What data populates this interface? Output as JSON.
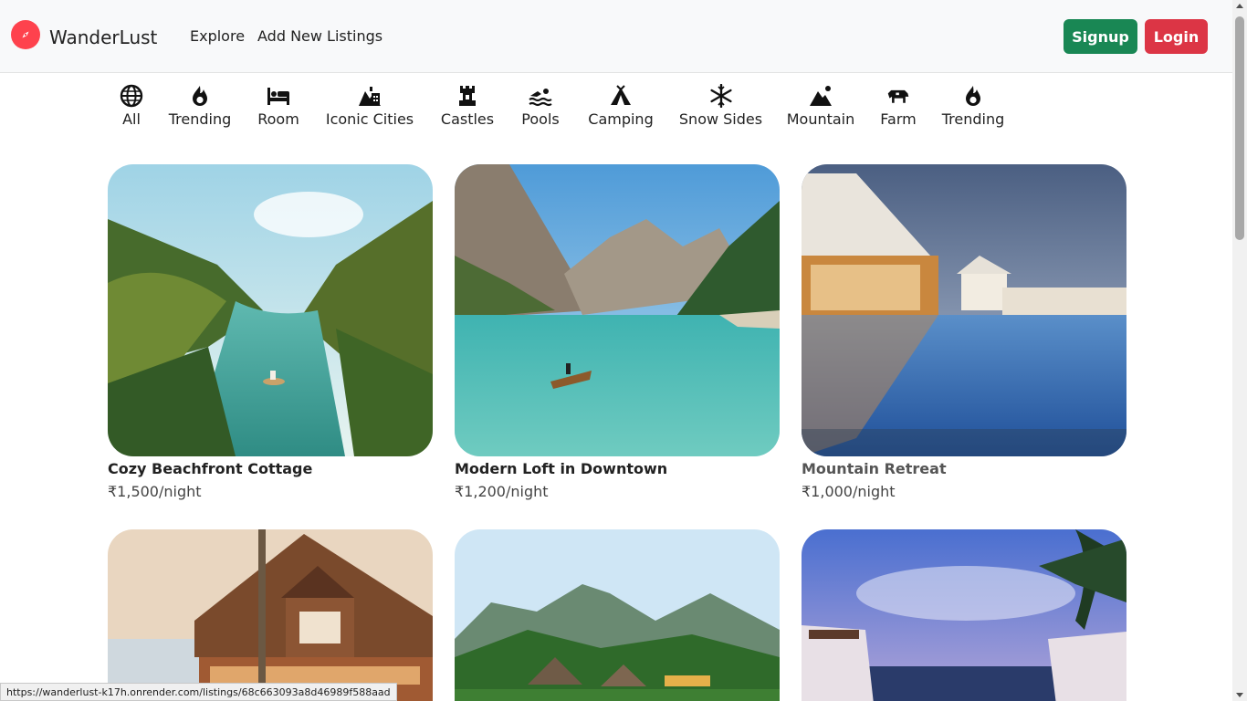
{
  "brand": {
    "name": "WanderLust",
    "icon": "compass-icon",
    "color": "#fe424d"
  },
  "nav": {
    "explore": "Explore",
    "add_listing": "Add New Listings"
  },
  "auth": {
    "signup": "Signup",
    "login": "Login",
    "signup_color": "#198754",
    "login_color": "#dc3545"
  },
  "filters": [
    {
      "label": "All",
      "icon": "globe-icon"
    },
    {
      "label": "Trending",
      "icon": "fire-icon"
    },
    {
      "label": "Room",
      "icon": "bed-icon"
    },
    {
      "label": "Iconic Cities",
      "icon": "city-icon"
    },
    {
      "label": "Castles",
      "icon": "castle-icon"
    },
    {
      "label": "Pools",
      "icon": "swimmer-icon"
    },
    {
      "label": "Camping",
      "icon": "tent-icon"
    },
    {
      "label": "Snow Sides",
      "icon": "snowflake-icon"
    },
    {
      "label": "Mountain",
      "icon": "mountain-icon"
    },
    {
      "label": "Farm",
      "icon": "cow-icon"
    },
    {
      "label": "Trending",
      "icon": "fire-icon"
    }
  ],
  "listings": [
    {
      "title": "Cozy Beachfront Cottage",
      "price": "₹1,500/night",
      "image": "tropical lagoon with canoe"
    },
    {
      "title": "Modern Loft in Downtown",
      "price": "₹1,200/night",
      "image": "mountain lake with rowing boat"
    },
    {
      "title": "Mountain Retreat",
      "price": "₹1,000/night",
      "image": "resort infinity pool"
    },
    {
      "title": "",
      "price": "",
      "image": "wooden lodge with palm tree"
    },
    {
      "title": "",
      "price": "",
      "image": "jungle bungalows with cliffs"
    },
    {
      "title": "",
      "price": "",
      "image": "beach cabanas at sunset"
    }
  ],
  "status_url": "https://wanderlust-k17h.onrender.com/listings/68c663093a8d46989f588aad"
}
